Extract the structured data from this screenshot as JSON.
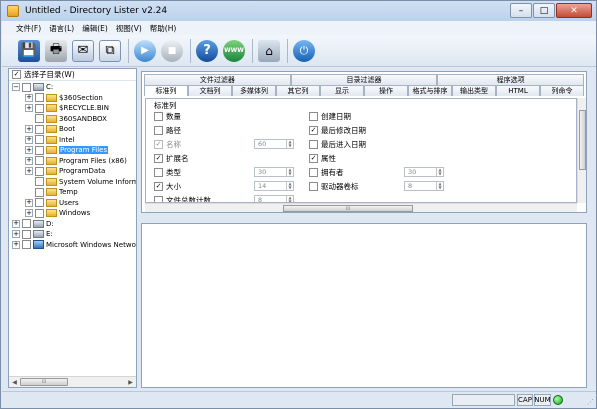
{
  "window": {
    "title": "Untitled - Directory Lister v2.24",
    "controls": {
      "minimize": "–",
      "maximize": "□",
      "close": "✕"
    }
  },
  "menu": [
    "文件(F)",
    "语言(L)",
    "编辑(E)",
    "视图(V)",
    "帮助(H)"
  ],
  "toolbar": {
    "icons": {
      "save": "floppy-disk-icon",
      "print": "printer-icon",
      "mail": "email-icon",
      "copy": "copy-icon",
      "play": "play-icon",
      "stop": "stop-icon",
      "help": "help-icon",
      "web": "website-icon",
      "home": "home-icon",
      "exit": "exit-icon"
    },
    "glyphs": {
      "save": "💾",
      "print": "🖶",
      "mail": "✉",
      "copy": "⧉",
      "play": "▶",
      "stop": "■",
      "help": "?",
      "web": "WWW",
      "home": "⌂",
      "exit": "⏻"
    }
  },
  "tree": {
    "root_label": "选择子目录(W)",
    "items": [
      {
        "label": "C:",
        "type": "drive",
        "expander": "−"
      },
      {
        "label": "$360Section",
        "type": "folder",
        "expander": "+"
      },
      {
        "label": "$RECYCLE.BIN",
        "type": "folder",
        "expander": "+"
      },
      {
        "label": "360SANDBOX",
        "type": "folder",
        "expander": ""
      },
      {
        "label": "Boot",
        "type": "folder",
        "expander": "+"
      },
      {
        "label": "Intel",
        "type": "folder",
        "expander": "+"
      },
      {
        "label": "Program Files",
        "type": "folder",
        "expander": "+",
        "selected": true
      },
      {
        "label": "Program Files (x86)",
        "type": "folder",
        "expander": "+"
      },
      {
        "label": "ProgramData",
        "type": "folder",
        "expander": "+"
      },
      {
        "label": "System Volume Informatio",
        "type": "folder",
        "expander": ""
      },
      {
        "label": "Temp",
        "type": "folder",
        "expander": ""
      },
      {
        "label": "Users",
        "type": "folder",
        "expander": "+"
      },
      {
        "label": "Windows",
        "type": "folder",
        "expander": "+"
      },
      {
        "label": "D:",
        "type": "drive",
        "expander": "+"
      },
      {
        "label": "E:",
        "type": "drive",
        "expander": "+"
      },
      {
        "label": "Microsoft Windows Network",
        "type": "network",
        "expander": "+"
      }
    ]
  },
  "tabs": {
    "top": [
      "文件过滤器",
      "目录过滤器",
      "程序选项"
    ],
    "bottom": [
      "标准列",
      "文档列",
      "多媒体列",
      "其它列",
      "显示",
      "操作",
      "格式与排序",
      "输出类型",
      "HTML",
      "列命令"
    ],
    "active": "标准列"
  },
  "standard_columns": {
    "group_title": "标准列",
    "left": [
      {
        "label": "数量",
        "checked": false
      },
      {
        "label": "路径",
        "checked": false
      },
      {
        "label": "名称",
        "checked": true,
        "disabled": true,
        "value": "60"
      },
      {
        "label": "扩展名",
        "checked": true
      },
      {
        "label": "类型",
        "checked": false,
        "value": "30"
      },
      {
        "label": "大小",
        "checked": true,
        "value": "14"
      },
      {
        "label": "文件总数计数",
        "checked": false,
        "value": "8"
      }
    ],
    "right": [
      {
        "label": "创建日期",
        "checked": false
      },
      {
        "label": "最后修改日期",
        "checked": true
      },
      {
        "label": "最后进入日期",
        "checked": false
      },
      {
        "label": "属性",
        "checked": true
      },
      {
        "label": "拥有者",
        "checked": false,
        "value": "30"
      },
      {
        "label": "驱动器卷标",
        "checked": false,
        "value": "8"
      }
    ]
  },
  "status": {
    "caps": "CAP",
    "num": "NUM"
  }
}
